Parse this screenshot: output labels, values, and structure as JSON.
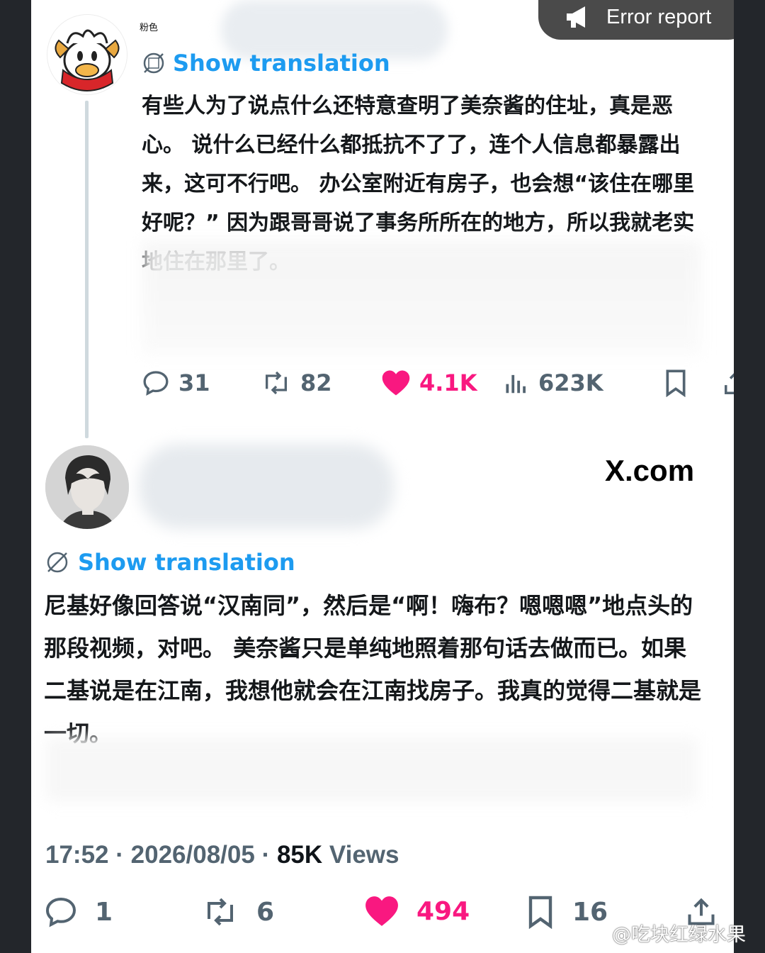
{
  "error_report": {
    "label": "Error report",
    "icon": "megaphone-icon"
  },
  "tweet1": {
    "username_small": "粉色",
    "translation_label": "Show translation",
    "text": "有些人为了说点什么还特意查明了美奈酱的住址，真是恶心。 说什么已经什么都抵抗不了了，连个人信息都暴露出来，这可不行吧。 办公室附近有房子，也会想“该住在哪里好呢？” 因为跟哥哥说了事务所所在的地方，所以我就老实地住在那里了。",
    "stats": {
      "replies": "31",
      "reposts": "82",
      "likes": "4.1K",
      "views": "623K"
    }
  },
  "tweet2": {
    "brand": "X.com",
    "translation_label": "Show translation",
    "text": "尼基好像回答说“汉南同”，然后是“啊！嗨布？嗯嗯嗯”地点头的那段视频，对吧。 美奈酱只是单纯地照着那句话去做而已。如果二基说是在江南，我想他就会在江南找房子。我真的觉得二基就是一切。",
    "time": "17:52",
    "date": "2026/08/05",
    "views_count": "85K",
    "views_label": "Views",
    "stats": {
      "replies": "1",
      "reposts": "6",
      "likes": "494",
      "bookmarks": "16"
    }
  },
  "watermark": "@吃块红绿水果",
  "colors": {
    "accent": "#1d9bf0",
    "like": "#f91880",
    "muted": "#536471"
  }
}
